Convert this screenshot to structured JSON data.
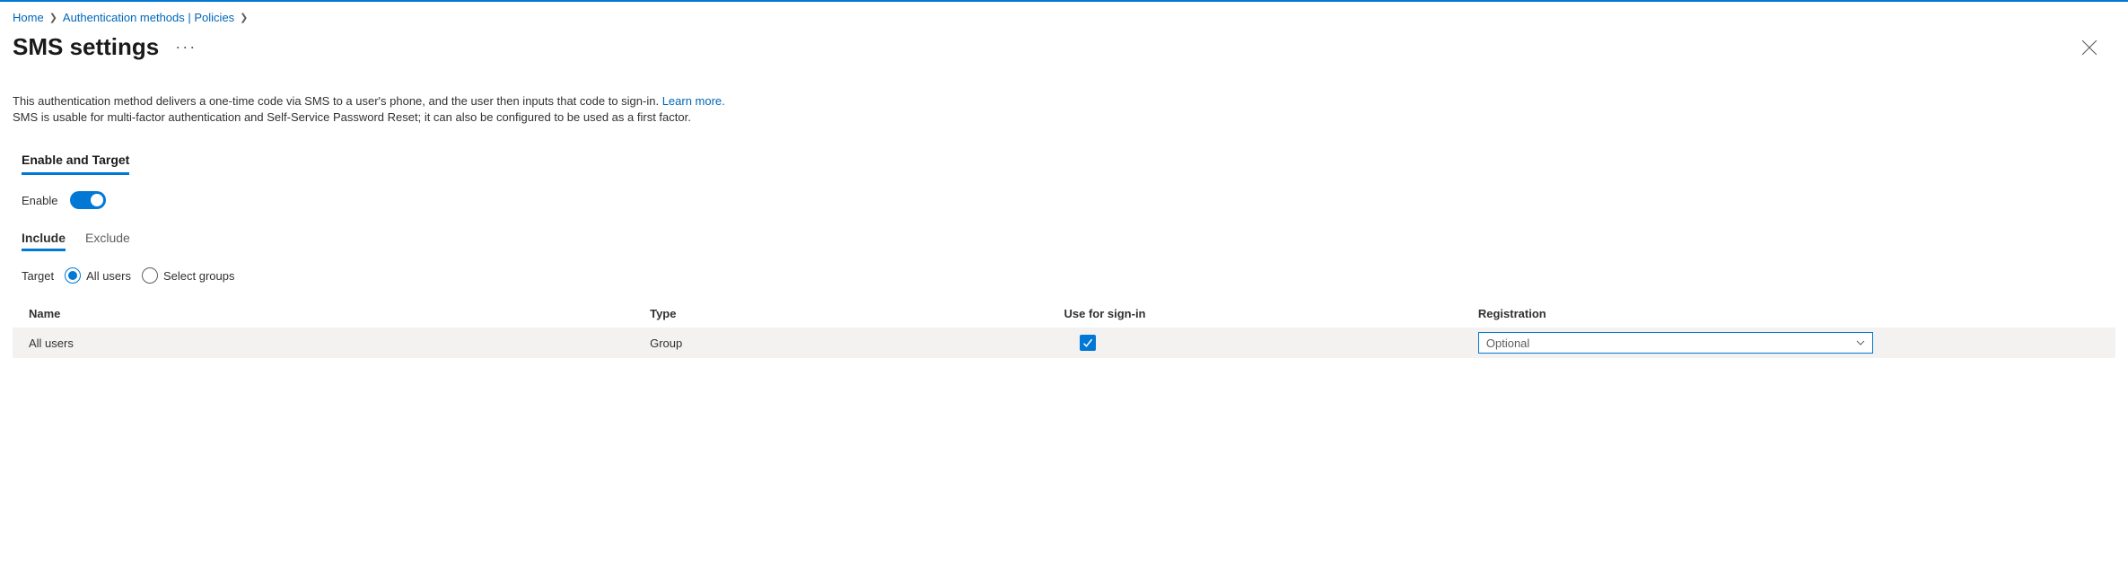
{
  "breadcrumb": {
    "home": "Home",
    "policies": "Authentication methods | Policies"
  },
  "title": "SMS settings",
  "description": {
    "line1_before": "This authentication method delivers a one-time code via SMS to a user's phone, and the user then inputs that code to sign-in. ",
    "learn_more": "Learn more.",
    "line2": "SMS is usable for multi-factor authentication and Self-Service Password Reset; it can also be configured to be used as a first factor."
  },
  "section_tab": "Enable and Target",
  "enable_label": "Enable",
  "subtabs": {
    "include": "Include",
    "exclude": "Exclude"
  },
  "target": {
    "label": "Target",
    "all_users": "All users",
    "select_groups": "Select groups"
  },
  "table": {
    "headers": {
      "name": "Name",
      "type": "Type",
      "signin": "Use for sign-in",
      "registration": "Registration"
    },
    "row": {
      "name": "All users",
      "type": "Group",
      "signin_checked": true,
      "registration": "Optional"
    }
  }
}
